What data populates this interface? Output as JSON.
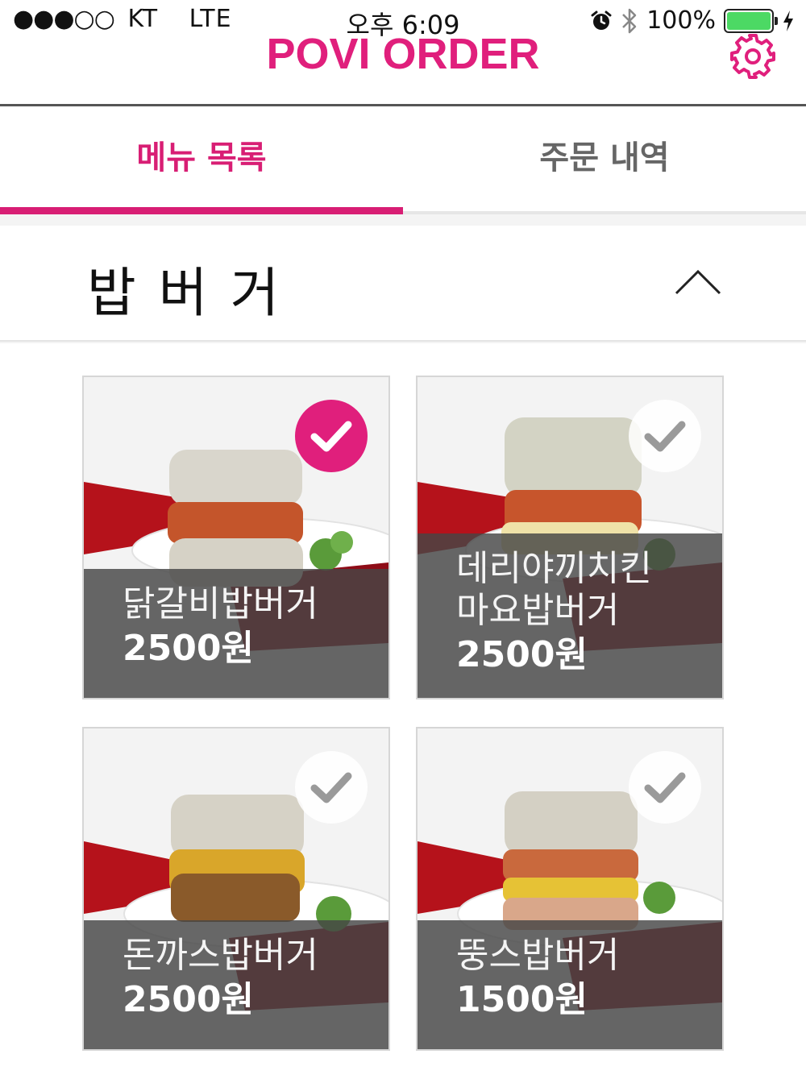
{
  "status_bar": {
    "signal": "●●●○○",
    "carrier": "KT",
    "network": "LTE",
    "time": "오후 6:09",
    "battery": "100%",
    "battery_level": 1.0
  },
  "header": {
    "title": "POVI ORDER",
    "settings_icon": "gear-icon"
  },
  "tabs": [
    {
      "label": "메뉴 목록",
      "active": true
    },
    {
      "label": "주문 내역",
      "active": false
    }
  ],
  "category": {
    "title": "밥버거",
    "expanded": true
  },
  "items": [
    {
      "name": "닭갈비밥버거",
      "price": "2500원",
      "selected": true
    },
    {
      "name": "데리야끼치킨\n마요밥버거",
      "price": "2500원",
      "selected": false
    },
    {
      "name": "돈까스밥버거",
      "price": "2500원",
      "selected": false
    },
    {
      "name": "뚱스밥버거",
      "price": "1500원",
      "selected": false
    }
  ],
  "colors": {
    "brand": "#e01f7c",
    "tab_active": "#d81e74",
    "overlay": "#464646"
  }
}
